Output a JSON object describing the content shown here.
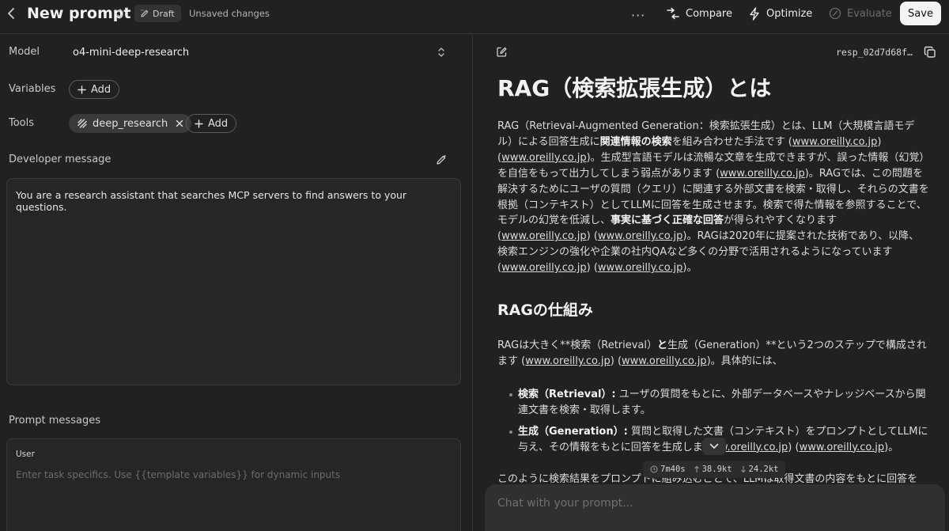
{
  "header": {
    "title": "New prompt",
    "draft_label": "Draft",
    "unsaved_label": "Unsaved changes",
    "more_label": "···",
    "compare_label": "Compare",
    "optimize_label": "Optimize",
    "evaluate_label": "Evaluate",
    "save_label": "Save"
  },
  "left": {
    "model_label": "Model",
    "model_value": "o4-mini-deep-research",
    "variables_label": "Variables",
    "add_label": "Add",
    "tools_label": "Tools",
    "tool_name": "deep_research",
    "developer_label": "Developer message",
    "developer_text": "You are a research assistant that searches MCP servers to find answers to your questions.",
    "prompt_messages_label": "Prompt messages",
    "user_label": "User",
    "user_placeholder": "Enter task specifics. Use {{template variables}} for dynamic inputs"
  },
  "right": {
    "response_id": "resp_02d7d68f…",
    "article": {
      "h1": "RAG（検索拡張生成）とは",
      "p1": [
        {
          "t": "RAG（Retrieval-Augmented Generation：検索拡張生成）とは、LLM（大規模言語モデル）による回答生成に"
        },
        {
          "t": "関連情報の検索",
          "b": true
        },
        {
          "t": "を組み合わせた手法です ("
        },
        {
          "t": "www.oreilly.co.jp",
          "a": true
        },
        {
          "t": ") ("
        },
        {
          "t": "www.oreilly.co.jp",
          "a": true
        },
        {
          "t": ")。生成型言語モデルは流暢な文章を生成できますが、誤った情報（幻覚）を自信をもって出力してしまう弱点があります ("
        },
        {
          "t": "www.oreilly.co.jp",
          "a": true
        },
        {
          "t": ")。RAGでは、この問題を解決するためにユーザの質問（クエリ）に関連する外部文書を検索・取得し、それらの文書を根拠（コンテキスト）としてLLMに回答を生成させます。検索で得た情報を参照することで、モデルの幻覚を低減し、"
        },
        {
          "t": "事実に基づく正確な回答",
          "b": true
        },
        {
          "t": "が得られやすくなります ("
        },
        {
          "t": "www.oreilly.co.jp",
          "a": true
        },
        {
          "t": ") ("
        },
        {
          "t": "www.oreilly.co.jp",
          "a": true
        },
        {
          "t": ")。RAGは2020年に提案された技術であり、以降、検索エンジンの強化や企業の社内QAなど多くの分野で活用されるようになっています ("
        },
        {
          "t": "www.oreilly.co.jp",
          "a": true
        },
        {
          "t": ") ("
        },
        {
          "t": "www.oreilly.co.jp",
          "a": true
        },
        {
          "t": ")。"
        }
      ],
      "h2": "RAGの仕組み",
      "p2": [
        {
          "t": "RAGは大きく**検索（Retrieval）"
        },
        {
          "t": "と",
          "b": true
        },
        {
          "t": "生成（Generation）**という2つのステップで構成されます ("
        },
        {
          "t": "www.oreilly.co.jp",
          "a": true
        },
        {
          "t": ") ("
        },
        {
          "t": "www.oreilly.co.jp",
          "a": true
        },
        {
          "t": ")。具体的には、"
        }
      ],
      "list": [
        [
          {
            "t": "検索（Retrieval）:",
            "b": true
          },
          {
            "t": " ユーザの質問をもとに、外部データベースやナレッジベースから関連文書を検索・取得します。"
          }
        ],
        [
          {
            "t": "生成（Generation）:",
            "b": true
          },
          {
            "t": " 質問と取得した文書（コンテキスト）をプロンプトとしてLLMに与え、その情報をもとに回答を生成しま"
          },
          {
            "t": "www.oreilly.co.jp",
            "a": true
          },
          {
            "t": ") ("
          },
          {
            "t": "www.oreilly.co.jp",
            "a": true
          },
          {
            "t": ")。"
          }
        ]
      ],
      "p3": "このように検索結果をプロンプトに組み込むことで、LLMは取得文書の内容をもとに回答を"
    },
    "stats": {
      "time": "7m40s",
      "up": "38.9kt",
      "down": "24.2kt"
    },
    "chat_placeholder": "Chat with your prompt..."
  }
}
